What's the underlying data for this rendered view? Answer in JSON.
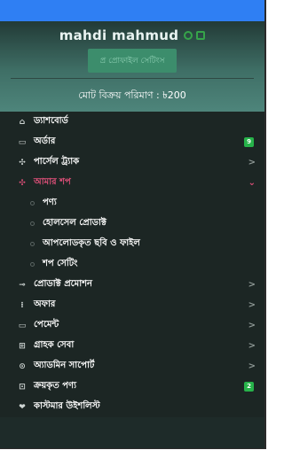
{
  "profile": {
    "name": "mahdi mahmud",
    "settings_button": "প্র প্রোফাইল সেটিংস",
    "total_sales_label": "মোট বিক্রয় পরিমাণ : ৳200"
  },
  "menu": [
    {
      "icon": "home-icon",
      "glyph": "⌂",
      "label": "ড্যাশবোর্ড"
    },
    {
      "icon": "order-icon",
      "glyph": "▭",
      "label": "অর্ডার",
      "badge": "9"
    },
    {
      "icon": "parcel-icon",
      "glyph": "✣",
      "label": "পার্সেল ট্র্যাক",
      "chevron": ">"
    },
    {
      "icon": "shop-icon",
      "glyph": "✣",
      "label": "আমার শপ",
      "chevron": "⌄",
      "active": true
    }
  ],
  "submenu": [
    "পণ্য",
    "হোলসেল প্রোডাক্ট",
    "আপলোডকৃত ছবি ও ফাইল",
    "শপ সেটিং"
  ],
  "menu2": [
    {
      "icon": "promotion-icon",
      "glyph": "⊸",
      "label": "প্রোডাক্ট প্রমোশন",
      "chevron": ">"
    },
    {
      "icon": "offer-icon",
      "glyph": "⁝",
      "label": "অফার",
      "chevron": ">"
    },
    {
      "icon": "payment-icon",
      "glyph": "▭",
      "label": "পেমেন্ট",
      "chevron": ">"
    },
    {
      "icon": "customer-service-icon",
      "glyph": "⊞",
      "label": "গ্রাহক সেবা",
      "chevron": ">"
    },
    {
      "icon": "admin-support-icon",
      "glyph": "⊙",
      "label": "অ্যাডমিন সাপোর্ট",
      "chevron": ">"
    },
    {
      "icon": "purchased-icon",
      "glyph": "⊡",
      "label": "ক্রয়কৃত পণ্য",
      "badge": "2"
    },
    {
      "icon": "heart-icon",
      "glyph": "❤",
      "label": "কাস্টমার উইশলিস্ট"
    }
  ]
}
